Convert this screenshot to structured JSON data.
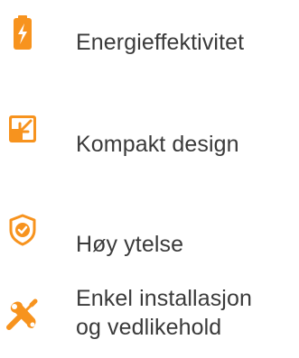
{
  "accent_color": "#F7931E",
  "text_color": "#3a3a3a",
  "features": [
    {
      "icon": "battery-charging-icon",
      "label": "Energieffektivitet"
    },
    {
      "icon": "resize-compact-icon",
      "label": "Kompakt design"
    },
    {
      "icon": "shield-check-icon",
      "label": "Høy ytelse"
    },
    {
      "icon": "tools-icon",
      "label": "Enkel installasjon",
      "label_line2": "og vedlikehold"
    }
  ]
}
